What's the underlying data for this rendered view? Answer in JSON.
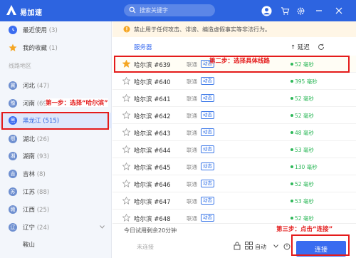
{
  "app": {
    "name": "易加速"
  },
  "search": {
    "placeholder": "搜索关键字"
  },
  "colors": {
    "accent": "#2d64e0",
    "annotation": "#e41b1b",
    "latency": "#2fb85a"
  },
  "sidebar": {
    "recent": {
      "label": "最近使用",
      "count": "(3)"
    },
    "favorites": {
      "label": "我的收藏",
      "count": "(1)"
    },
    "section_title": "线路地区",
    "regions": [
      {
        "abbr": "冀",
        "label": "河北",
        "count": "(47)",
        "color": "#6e8fd0"
      },
      {
        "abbr": "豫",
        "label": "河南",
        "count": "(69)",
        "color": "#6e8fd0"
      },
      {
        "abbr": "黑",
        "label": "黑龙江",
        "count": "(515)",
        "color": "#3a6cf0"
      },
      {
        "abbr": "鄂",
        "label": "湖北",
        "count": "(26)",
        "color": "#6e8fd0"
      },
      {
        "abbr": "湘",
        "label": "湖南",
        "count": "(93)",
        "color": "#6e8fd0"
      },
      {
        "abbr": "吉",
        "label": "吉林",
        "count": "(8)",
        "color": "#6e8fd0"
      },
      {
        "abbr": "苏",
        "label": "江苏",
        "count": "(88)",
        "color": "#6e8fd0"
      },
      {
        "abbr": "赣",
        "label": "江西",
        "count": "(25)",
        "color": "#6e8fd0"
      },
      {
        "abbr": "辽",
        "label": "辽宁",
        "count": "(24)",
        "color": "#6e8fd0"
      }
    ],
    "sub_item": "鞍山"
  },
  "notice": {
    "text": "禁止用于任何攻击、诽谤、编造虚假事实等非法行为。"
  },
  "table": {
    "header_server": "服务器",
    "header_latency": "↑ 延迟",
    "rows": [
      {
        "name": "哈尔滨 #639",
        "isp": "联通",
        "tag": "动态",
        "latency": "52 毫秒",
        "starred": true
      },
      {
        "name": "哈尔滨 #640",
        "isp": "联通",
        "tag": "动态",
        "latency": "395 毫秒",
        "starred": false
      },
      {
        "name": "哈尔滨 #641",
        "isp": "联通",
        "tag": "动态",
        "latency": "52 毫秒",
        "starred": false
      },
      {
        "name": "哈尔滨 #642",
        "isp": "联通",
        "tag": "动态",
        "latency": "52 毫秒",
        "starred": false
      },
      {
        "name": "哈尔滨 #643",
        "isp": "联通",
        "tag": "动态",
        "latency": "48 毫秒",
        "starred": false
      },
      {
        "name": "哈尔滨 #644",
        "isp": "联通",
        "tag": "动态",
        "latency": "53 毫秒",
        "starred": false
      },
      {
        "name": "哈尔滨 #645",
        "isp": "联通",
        "tag": "动态",
        "latency": "130 毫秒",
        "starred": false
      },
      {
        "name": "哈尔滨 #646",
        "isp": "联通",
        "tag": "动态",
        "latency": "52 毫秒",
        "starred": false
      },
      {
        "name": "哈尔滨 #647",
        "isp": "联通",
        "tag": "动态",
        "latency": "53 毫秒",
        "starred": false
      },
      {
        "name": "哈尔滨 #648",
        "isp": "联通",
        "tag": "动态",
        "latency": "52 毫秒",
        "starred": false
      }
    ]
  },
  "bottom": {
    "trial_text": "今日试用剩余20分钟",
    "status": "未连接",
    "mode": "自动",
    "connect_label": "连接"
  },
  "annotations": {
    "step1": "第一步：选择“哈尔滨”",
    "step2": "第二步：选择具体线路",
    "step3": "第三步：点击“连接”"
  }
}
